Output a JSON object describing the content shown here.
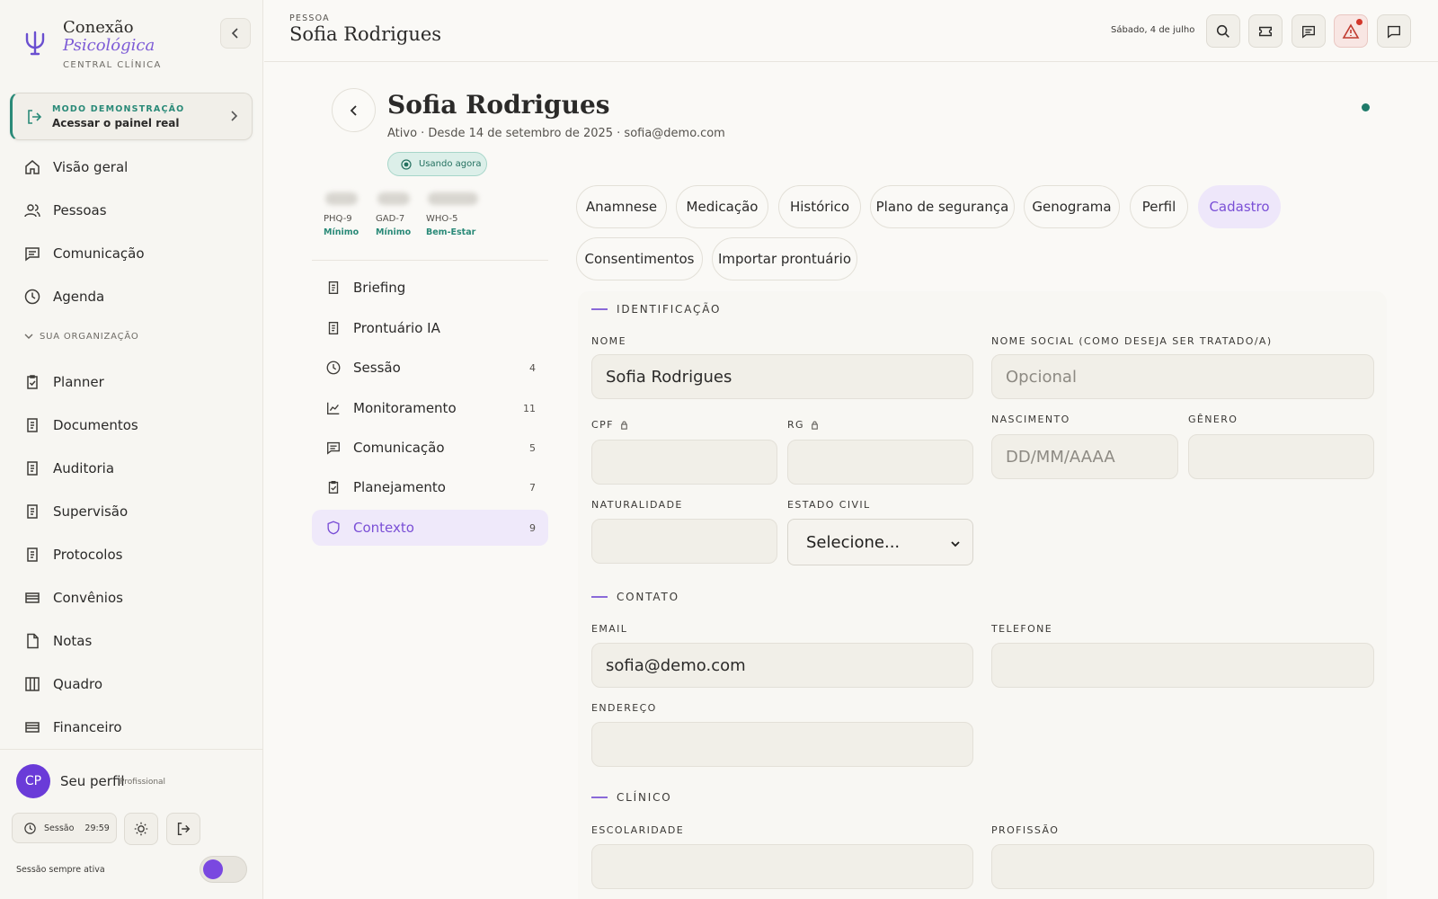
{
  "brand": {
    "line1": "Conexão",
    "line2": "Psicológica",
    "line3": "CENTRAL CLÍNICA"
  },
  "demo": {
    "kicker": "MODO DEMONSTRAÇÃO",
    "label": "Acessar o painel real"
  },
  "nav": {
    "main": [
      {
        "label": "Visão geral",
        "icon": "home-icon"
      },
      {
        "label": "Pessoas",
        "icon": "users-icon"
      },
      {
        "label": "Comunicação",
        "icon": "message-icon"
      },
      {
        "label": "Agenda",
        "icon": "clock-icon"
      }
    ],
    "org_header": "SUA ORGANIZAÇÃO",
    "org": [
      {
        "label": "Planner",
        "icon": "clipboard-check-icon"
      },
      {
        "label": "Documentos",
        "icon": "document-icon"
      },
      {
        "label": "Auditoria",
        "icon": "document-icon"
      },
      {
        "label": "Supervisão",
        "icon": "document-icon"
      },
      {
        "label": "Protocolos",
        "icon": "document-icon"
      },
      {
        "label": "Convênios",
        "icon": "card-icon"
      },
      {
        "label": "Notas",
        "icon": "file-icon"
      },
      {
        "label": "Quadro",
        "icon": "columns-icon"
      },
      {
        "label": "Financeiro",
        "icon": "card-icon"
      }
    ]
  },
  "profile": {
    "initials": "CP",
    "name": "Seu perfil",
    "role": "Profissional"
  },
  "session": {
    "label": "Sessão",
    "time": "29:59",
    "always_label": "Sessão sempre ativa",
    "always_on": true
  },
  "header": {
    "kicker": "PESSOA",
    "title": "Sofia Rodrigues",
    "date": "Sábado, 4 de julho"
  },
  "patient": {
    "name": "Sofia Rodrigues",
    "subtitle": "Ativo · Desde 14 de setembro de 2025 · sofia@demo.com",
    "badge": "Usando agora",
    "scores": [
      {
        "name": "PHQ-9",
        "level": "Mínimo"
      },
      {
        "name": "GAD-7",
        "level": "Mínimo"
      },
      {
        "name": "WHO-5",
        "level": "Bem-Estar"
      }
    ]
  },
  "patient_menu": [
    {
      "label": "Briefing",
      "count": "",
      "icon": "document-icon"
    },
    {
      "label": "Prontuário IA",
      "count": "",
      "icon": "document-icon"
    },
    {
      "label": "Sessão",
      "count": "4",
      "icon": "clock-icon"
    },
    {
      "label": "Monitoramento",
      "count": "11",
      "icon": "chart-line-icon"
    },
    {
      "label": "Comunicação",
      "count": "5",
      "icon": "message-icon"
    },
    {
      "label": "Planejamento",
      "count": "7",
      "icon": "clipboard-check-icon"
    },
    {
      "label": "Contexto",
      "count": "9",
      "icon": "shield-icon",
      "active": true
    }
  ],
  "tabs": [
    {
      "label": "Anamnese"
    },
    {
      "label": "Medicação"
    },
    {
      "label": "Histórico"
    },
    {
      "label": "Plano de segurança"
    },
    {
      "label": "Genograma"
    },
    {
      "label": "Perfil"
    },
    {
      "label": "Cadastro",
      "active": true
    },
    {
      "label": "Consentimentos"
    },
    {
      "label": "Importar prontuário"
    }
  ],
  "form": {
    "sections": {
      "identificacao": "IDENTIFICAÇÃO",
      "contato": "CONTATO",
      "clinico": "CLÍNICO"
    },
    "fields": {
      "nome": {
        "label": "NOME",
        "value": "Sofia Rodrigues",
        "placeholder": ""
      },
      "nome_social": {
        "label": "NOME SOCIAL (COMO DESEJA SER TRATADO/A)",
        "value": "",
        "placeholder": "Opcional"
      },
      "cpf": {
        "label": "CPF",
        "value": "",
        "placeholder": ""
      },
      "rg": {
        "label": "RG",
        "value": "",
        "placeholder": ""
      },
      "nascimento": {
        "label": "NASCIMENTO",
        "value": "",
        "placeholder": "DD/MM/AAAA"
      },
      "genero": {
        "label": "GÊNERO",
        "value": "",
        "placeholder": ""
      },
      "naturalidade": {
        "label": "NATURALIDADE",
        "value": "",
        "placeholder": ""
      },
      "estado_civil": {
        "label": "ESTADO CIVIL",
        "value": "Selecione..."
      },
      "email": {
        "label": "EMAIL",
        "value": "sofia@demo.com",
        "placeholder": ""
      },
      "telefone": {
        "label": "TELEFONE",
        "value": "",
        "placeholder": ""
      },
      "endereco": {
        "label": "ENDEREÇO",
        "value": "",
        "placeholder": ""
      },
      "escolaridade": {
        "label": "ESCOLARIDADE",
        "value": "",
        "placeholder": ""
      },
      "profissao": {
        "label": "PROFISSÃO",
        "value": "",
        "placeholder": ""
      }
    }
  },
  "colors": {
    "accent": "#7a4fd6",
    "teal": "#2a8a78",
    "alert": "#d3372b",
    "avatar": "#6a3bd8"
  }
}
